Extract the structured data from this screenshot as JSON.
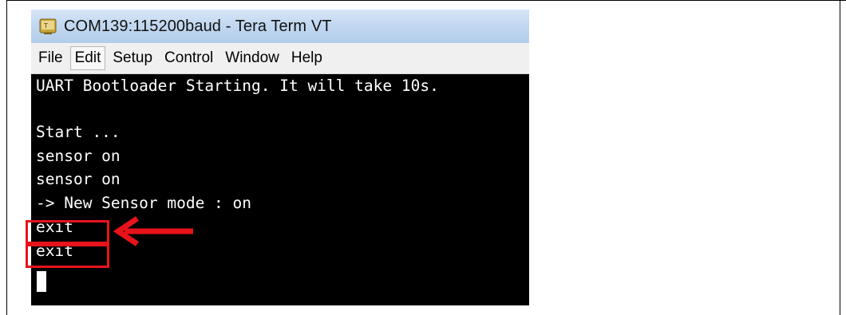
{
  "window": {
    "title": "COM139:115200baud - Tera Term VT",
    "icon": "teraterm-app-icon"
  },
  "menu": {
    "items": [
      {
        "label": "File",
        "active": false
      },
      {
        "label": "Edit",
        "active": true
      },
      {
        "label": "Setup",
        "active": false
      },
      {
        "label": "Control",
        "active": false
      },
      {
        "label": "Window",
        "active": false
      },
      {
        "label": "Help",
        "active": false
      }
    ]
  },
  "terminal": {
    "lines": [
      "UART Bootloader Starting. It will take 10s.",
      "",
      "Start ...",
      "sensor on",
      "sensor on",
      "-> New Sensor mode : on",
      "exit",
      "exit"
    ],
    "background": "#000000",
    "foreground": "#ffffff"
  },
  "annotations": {
    "highlight_color": "#e8131a",
    "arrow_icon": "left-arrow-icon"
  }
}
